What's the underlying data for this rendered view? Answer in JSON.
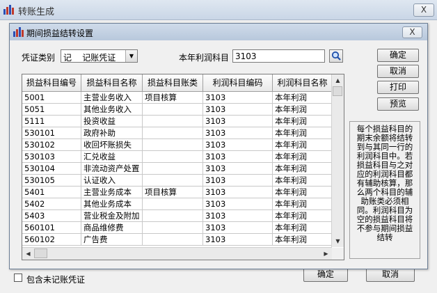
{
  "outer": {
    "title": "转账生成",
    "close_label": "X",
    "include_unposted_label": "包含未记账凭证",
    "ok_label": "确定",
    "cancel_label": "取消"
  },
  "dialog": {
    "title": "期间损益结转设置",
    "close_label": "X",
    "voucher_type_label": "凭证类别",
    "voucher_type_value": "记    记账凭证",
    "profit_account_label": "本年利润科目",
    "profit_account_value": "3103",
    "buttons": {
      "ok": "确定",
      "cancel": "取消",
      "print": "打印",
      "preview": "预览"
    },
    "note": "每个损益科目的期末余额将结转到与其同一行的利润科目中。若损益科目与之对应的利润科目都有辅助核算，那么两个科目的辅助账类必须相同。利润科目为空的损益科目将不参与期间损益结转"
  },
  "grid": {
    "columns": [
      "损益科目编号",
      "损益科目名称",
      "损益科目账类",
      "利润科目编码",
      "利润科目名称"
    ],
    "rows": [
      [
        "5001",
        "主营业务收入",
        "项目核算",
        "3103",
        "本年利润"
      ],
      [
        "5051",
        "其他业务收入",
        "",
        "3103",
        "本年利润"
      ],
      [
        "5111",
        "投资收益",
        "",
        "3103",
        "本年利润"
      ],
      [
        "530101",
        "政府补助",
        "",
        "3103",
        "本年利润"
      ],
      [
        "530102",
        "收回坏账损失",
        "",
        "3103",
        "本年利润"
      ],
      [
        "530103",
        "汇兑收益",
        "",
        "3103",
        "本年利润"
      ],
      [
        "530104",
        "非流动资产处置",
        "",
        "3103",
        "本年利润"
      ],
      [
        "530105",
        "认证收入",
        "",
        "3103",
        "本年利润"
      ],
      [
        "5401",
        "主营业务成本",
        "项目核算",
        "3103",
        "本年利润"
      ],
      [
        "5402",
        "其他业务成本",
        "",
        "3103",
        "本年利润"
      ],
      [
        "5403",
        "营业税金及附加",
        "",
        "3103",
        "本年利润"
      ],
      [
        "560101",
        "商品维修费",
        "",
        "3103",
        "本年利润"
      ],
      [
        "560102",
        "广告费",
        "",
        "3103",
        "本年利润"
      ]
    ]
  }
}
